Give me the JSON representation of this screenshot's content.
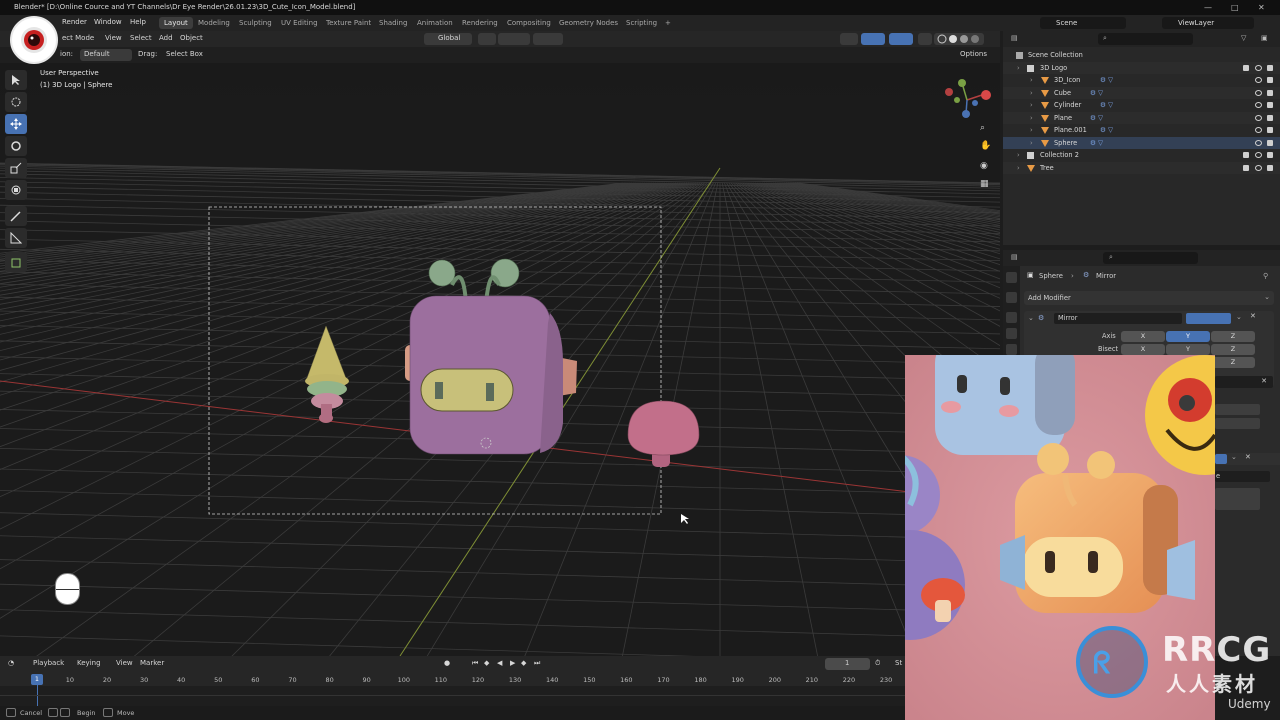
{
  "title_bar": {
    "text": "Blender* [D:\\Online Cource and YT Channels\\Dr Eye Render\\26.01.23\\3D_Cute_Icon_Model.blend]"
  },
  "menus": [
    "Render",
    "Window",
    "Help"
  ],
  "workspaces": [
    "Layout",
    "Modeling",
    "Sculpting",
    "UV Editing",
    "Texture Paint",
    "Shading",
    "Animation",
    "Rendering",
    "Compositing",
    "Geometry Nodes",
    "Scripting",
    "+"
  ],
  "active_workspace": "Layout",
  "scene": {
    "name": "Scene",
    "view_layer": "ViewLayer"
  },
  "viewport_header": {
    "mode": "ect Mode",
    "view": "View",
    "select": "Select",
    "add": "Add",
    "object": "Object",
    "orientation": "Global",
    "options": "Options"
  },
  "tool_header": {
    "orientation_label": "ion:",
    "orientation_value": "Default",
    "drag_label": "Drag:",
    "drag_value": "Select Box"
  },
  "viewport": {
    "perspective": "User Perspective",
    "active": "(1) 3D Logo | Sphere"
  },
  "outliner": {
    "header": "Scene Collection",
    "rows": [
      {
        "name": "3D Logo",
        "indent": 1,
        "type": "collection"
      },
      {
        "name": "3D_Icon",
        "indent": 2,
        "type": "mesh"
      },
      {
        "name": "Cube",
        "indent": 2,
        "type": "mesh"
      },
      {
        "name": "Cylinder",
        "indent": 2,
        "type": "mesh"
      },
      {
        "name": "Plane",
        "indent": 2,
        "type": "mesh"
      },
      {
        "name": "Plane.001",
        "indent": 2,
        "type": "mesh"
      },
      {
        "name": "Sphere",
        "indent": 2,
        "type": "mesh"
      },
      {
        "name": "Collection 2",
        "indent": 1,
        "type": "collection"
      },
      {
        "name": "Tree",
        "indent": 1,
        "type": "mesh"
      }
    ],
    "badges": {
      "collection2": "2",
      "tree": "4"
    }
  },
  "properties": {
    "breadcrumb_object": "Sphere",
    "breadcrumb_modifier": "Mirror",
    "add_modifier": "Add Modifier",
    "modifier_name": "Mirror",
    "axis_label": "Axis",
    "bisect_label": "Bisect",
    "axes": [
      "X",
      "Y",
      "Z"
    ],
    "active_axis": "Y",
    "partial_text": "e"
  },
  "timeline": {
    "playback": "Playback",
    "keying": "Keying",
    "view": "View",
    "marker": "Marker",
    "current_frame": "1",
    "start_label": "St",
    "frames": [
      "10",
      "20",
      "30",
      "40",
      "50",
      "60",
      "70",
      "80",
      "90",
      "100",
      "110",
      "120",
      "130",
      "140",
      "150",
      "160",
      "170",
      "180",
      "190",
      "200",
      "210",
      "220",
      "230"
    ],
    "current_frame_marker": "1"
  },
  "statusbar": {
    "cancel": "Cancel",
    "begin": "Begin",
    "move": "Move"
  },
  "watermark": {
    "brand": "RRCG",
    "subtitle": "人人素材",
    "provider": "Udemy"
  },
  "colors": {
    "accent": "#4772b3",
    "grid": "#3a3a3a",
    "axis_red": "#a83838",
    "axis_green": "#8a9a3a"
  }
}
